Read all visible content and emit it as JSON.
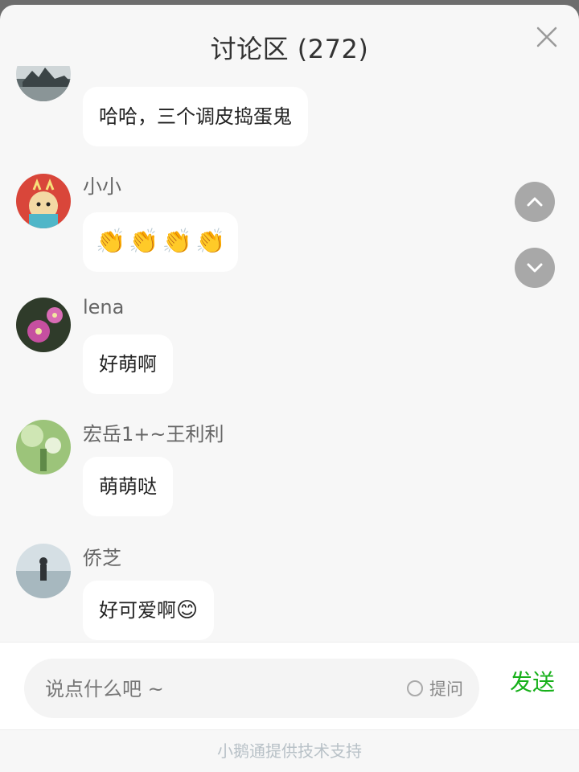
{
  "header": {
    "title": "讨论区 (272)"
  },
  "controls": {
    "close_icon": "close-icon",
    "scroll_up_icon": "chevron-up-icon",
    "scroll_down_icon": "chevron-down-icon"
  },
  "messages": [
    {
      "name": "",
      "text": "哈哈，三个调皮捣蛋鬼",
      "avatar": "landscape-avatar"
    },
    {
      "name": "小小",
      "text": "",
      "emojis": [
        "👏",
        "👏",
        "👏",
        "👏"
      ],
      "avatar": "cartoon-avatar"
    },
    {
      "name": "lena",
      "text": "好萌啊",
      "avatar": "flower-avatar"
    },
    {
      "name": "宏岳1+~王利利",
      "text": "萌萌哒",
      "avatar": "plant-avatar"
    },
    {
      "name": "侨芝",
      "text": "好可爱啊",
      "emoji": "😊",
      "avatar": "lake-avatar"
    }
  ],
  "composer": {
    "placeholder": "说点什么吧 ~",
    "ask_label": "提问",
    "send_label": "发送"
  },
  "footer": {
    "text": "小鹅通提供技术支持"
  },
  "colors": {
    "send": "#17b01a",
    "bubble": "#ffffff",
    "background": "#f7f7f7"
  }
}
